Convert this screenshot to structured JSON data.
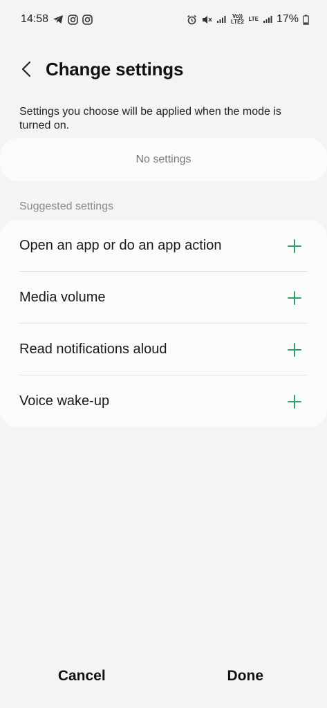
{
  "status_bar": {
    "time": "14:58",
    "volte_text": "Vo)) LTE2",
    "lte_text": "LTE",
    "battery_percent": "17%",
    "icons": [
      "telegram-icon",
      "instagram-icon",
      "instagram-icon",
      "alarm-icon",
      "mute-icon",
      "signal-icon",
      "signal-icon",
      "battery-icon"
    ]
  },
  "header": {
    "title": "Change settings",
    "back_icon": "chevron-left-icon"
  },
  "description": "Settings you choose will be applied when the mode is turned on.",
  "selected_settings": {
    "empty_label": "No settings"
  },
  "suggested": {
    "header": "Suggested settings",
    "items": [
      {
        "label": "Open an app or do an app action",
        "icon": "plus-icon"
      },
      {
        "label": "Media volume",
        "icon": "plus-icon"
      },
      {
        "label": "Read notifications aloud",
        "icon": "plus-icon"
      },
      {
        "label": "Voice wake-up",
        "icon": "plus-icon"
      }
    ]
  },
  "footer": {
    "cancel_label": "Cancel",
    "done_label": "Done"
  },
  "colors": {
    "background": "#f4f4f4",
    "card": "#fbfbfb",
    "accent_plus": "#2e9f6a"
  }
}
